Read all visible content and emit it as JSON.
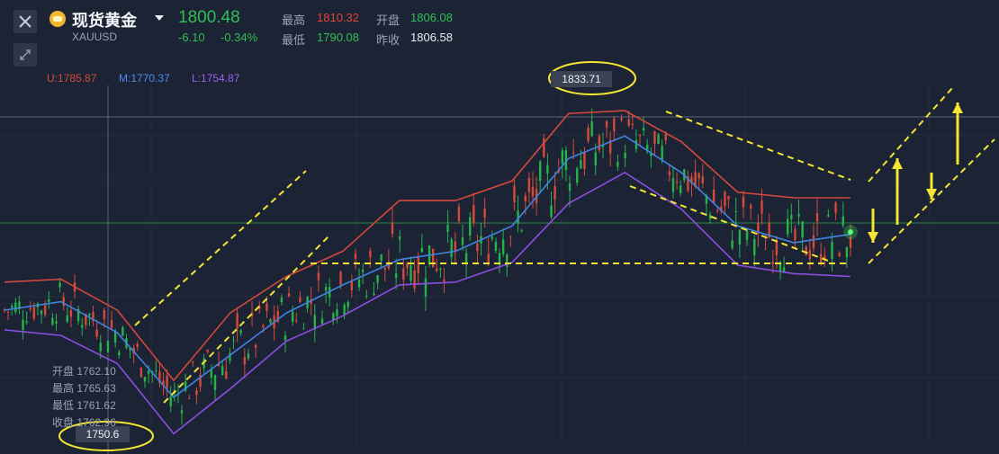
{
  "header": {
    "name": "现货黄金",
    "symbol": "XAUUSD",
    "price": "1800.48",
    "change": "-6.10",
    "change_pct": "-0.34%",
    "stats": [
      {
        "label": "最高",
        "value": "1810.32"
      },
      {
        "label": "开盘",
        "value": "1806.08"
      },
      {
        "label": "最低",
        "value": "1790.08"
      },
      {
        "label": "昨收",
        "value": "1806.58"
      }
    ]
  },
  "buttons": {
    "close": "close-icon",
    "collapse": "collapse-icon"
  },
  "colors": {
    "background": "#1c2334",
    "up": "#26b34a",
    "down": "#d64a3a",
    "upper_band": "#d2483a",
    "middle_band": "#3f84e0",
    "lower_band": "#8b4fe0",
    "annotation": "#f2e632",
    "price_line": "#26b34a"
  },
  "chart_data": {
    "type": "line",
    "indicator": "Bollinger Bands",
    "legend": [
      {
        "name": "U",
        "value": "1785.87"
      },
      {
        "name": "M",
        "value": "1770.37"
      },
      {
        "name": "L",
        "value": "1754.87"
      }
    ],
    "ylim": [
      1728,
      1856
    ],
    "x_points": 16,
    "series": [
      {
        "name": "U",
        "values": [
          1786,
          1787,
          1776,
          1751,
          1775,
          1788,
          1797,
          1815,
          1815,
          1822,
          1846,
          1847,
          1836,
          1818,
          1816,
          1816
        ]
      },
      {
        "name": "M",
        "values": [
          1776,
          1779,
          1768,
          1745,
          1760,
          1775,
          1785,
          1794,
          1797,
          1806,
          1830,
          1838,
          1825,
          1806,
          1800,
          1803
        ]
      },
      {
        "name": "L",
        "values": [
          1769,
          1767,
          1757,
          1732,
          1748,
          1765,
          1774,
          1785,
          1786,
          1793,
          1814,
          1825,
          1812,
          1792,
          1789,
          1788
        ]
      }
    ],
    "ohlc_tooltip": [
      {
        "label": "开盘",
        "value": "1762.10"
      },
      {
        "label": "最高",
        "value": "1765.63"
      },
      {
        "label": "最低",
        "value": "1761.62"
      },
      {
        "label": "收盘",
        "value": "1762.96"
      }
    ],
    "annotations": {
      "high_label": "1833.71",
      "low_label": "1750.6"
    }
  }
}
